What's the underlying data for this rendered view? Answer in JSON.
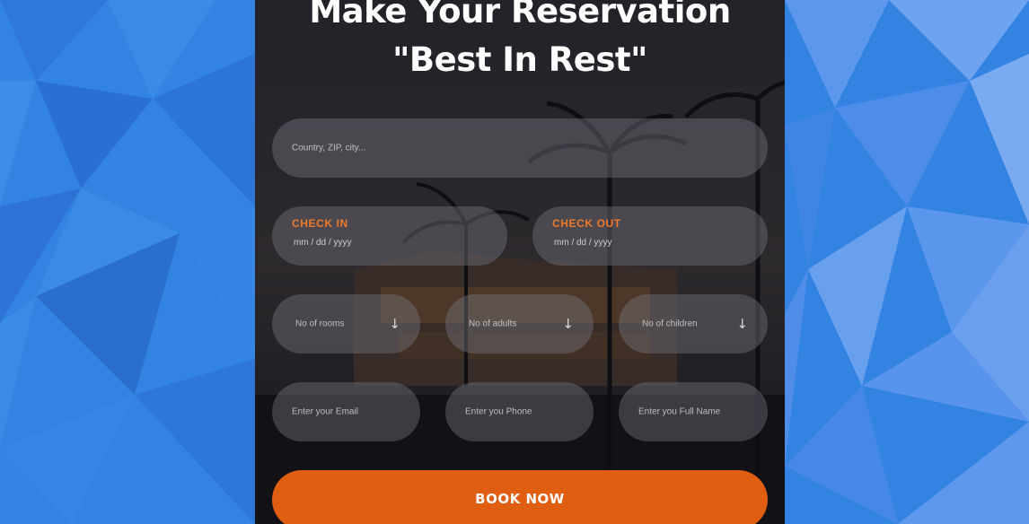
{
  "header": {
    "title": "Make Your Reservation \"Best In Rest\""
  },
  "search": {
    "placeholder": "Country, ZIP, city..."
  },
  "check_in": {
    "label": "CHECK IN",
    "placeholder": "mm / dd / yyyy"
  },
  "check_out": {
    "label": "CHECK OUT",
    "placeholder": "mm / dd / yyyy"
  },
  "selects": {
    "rooms": "No of rooms",
    "adults": "No of adults",
    "children": "No of children",
    "arrow": "↓"
  },
  "contact": {
    "email": "Enter your Email",
    "phone": "Enter you Phone",
    "name": "Enter you Full Name"
  },
  "actions": {
    "book_label": "BOOK NOW"
  },
  "colors": {
    "accent": "#e05e12",
    "label": "#f07a2a",
    "background": "#2f7fe0"
  },
  "icons": {
    "select_arrow": "arrow-down-icon"
  }
}
